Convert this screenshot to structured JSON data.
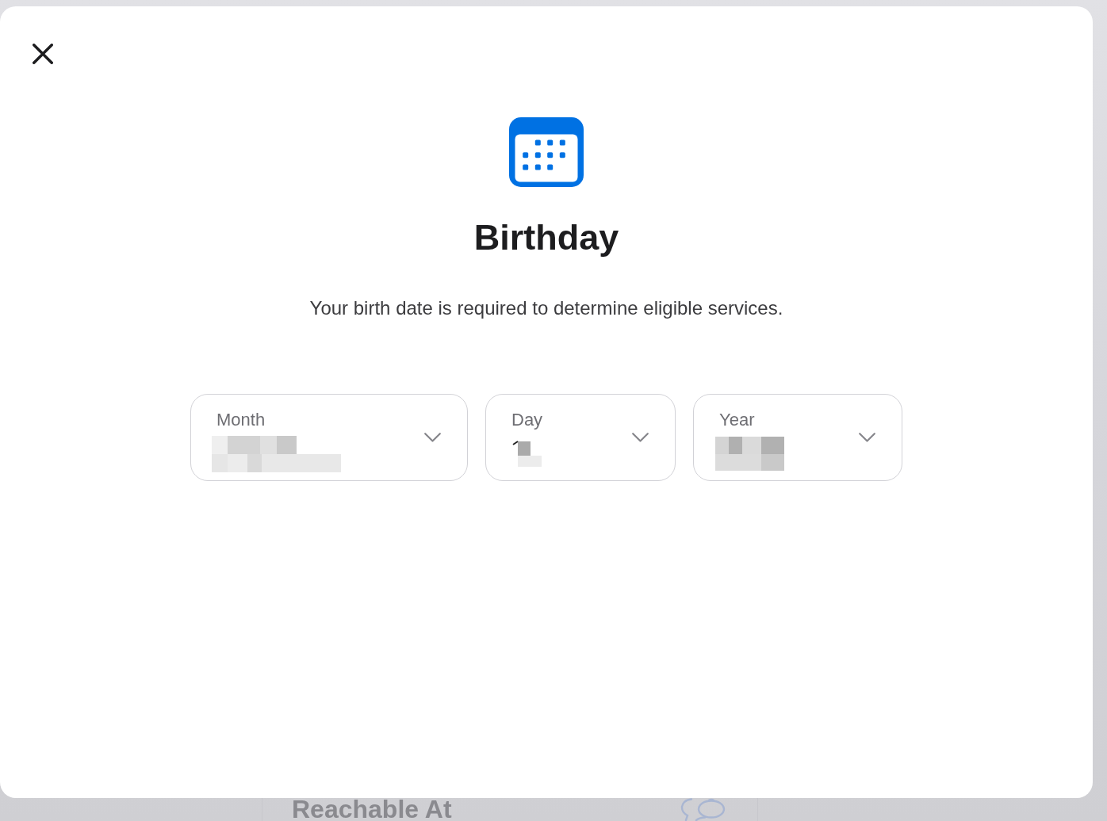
{
  "dialog": {
    "title": "Birthday",
    "description": "Your birth date is required to determine eligible services.",
    "fields": [
      {
        "label": "Month",
        "redacted": true
      },
      {
        "label": "Day",
        "redacted": true
      },
      {
        "label": "Year",
        "redacted": true
      }
    ]
  },
  "background": {
    "section_title": "Reachable At"
  }
}
